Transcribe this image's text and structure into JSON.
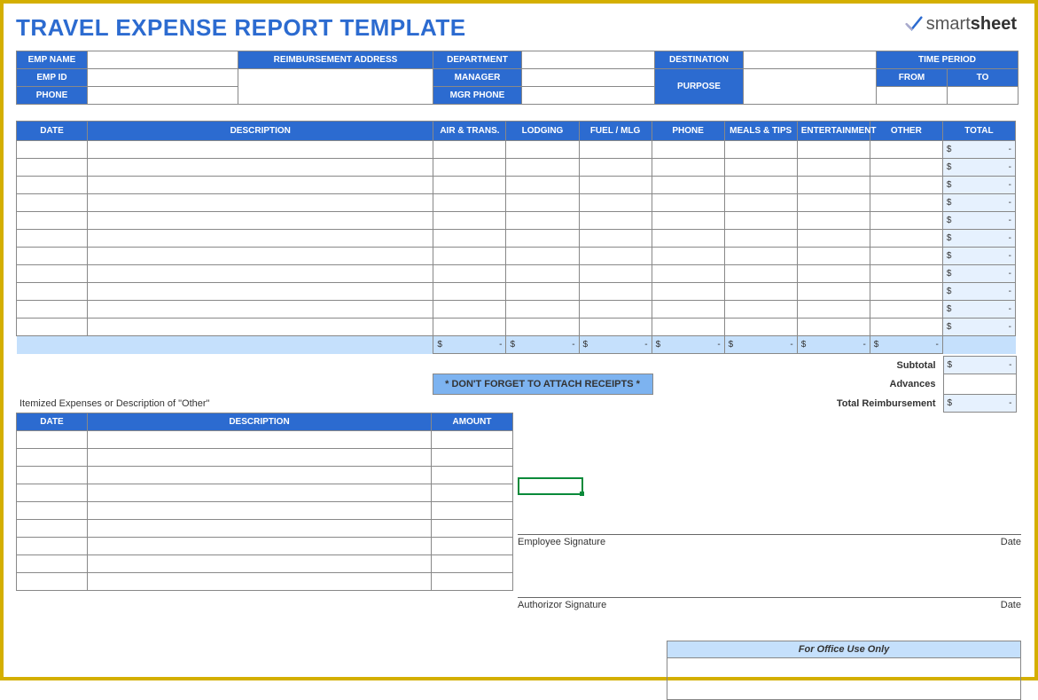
{
  "title": "TRAVEL EXPENSE REPORT TEMPLATE",
  "logo": {
    "brand1": "smart",
    "brand2": "sheet"
  },
  "header_labels": {
    "emp_name": "EMP NAME",
    "reimb_addr": "REIMBURSEMENT ADDRESS",
    "department": "DEPARTMENT",
    "destination": "DESTINATION",
    "time_period": "TIME PERIOD",
    "emp_id": "EMP ID",
    "manager": "MANAGER",
    "purpose": "PURPOSE",
    "from": "FROM",
    "to": "TO",
    "phone": "PHONE",
    "mgr_phone": "MGR PHONE"
  },
  "main_columns": [
    "DATE",
    "DESCRIPTION",
    "AIR & TRANS.",
    "LODGING",
    "FUEL / MLG",
    "PHONE",
    "MEALS & TIPS",
    "ENTERTAINMENT",
    "OTHER",
    "TOTAL"
  ],
  "main_rows": 11,
  "row_total_placeholder": {
    "currency": "$",
    "value": "-"
  },
  "subtotal_cols_placeholder": {
    "currency": "$",
    "value": "-"
  },
  "reminder": "* DON'T FORGET TO ATTACH RECEIPTS *",
  "summary": {
    "subtotal": "Subtotal",
    "advances": "Advances",
    "total_reimbursement": "Total Reimbursement"
  },
  "summary_values": {
    "currency": "$",
    "value": "-"
  },
  "itemized_caption": "Itemized Expenses or Description of \"Other\"",
  "itemized_columns": [
    "DATE",
    "DESCRIPTION",
    "AMOUNT"
  ],
  "itemized_rows": 9,
  "signatures": {
    "employee": "Employee Signature",
    "authorizor": "Authorizor Signature",
    "date": "Date"
  },
  "office_use": "For Office Use Only"
}
